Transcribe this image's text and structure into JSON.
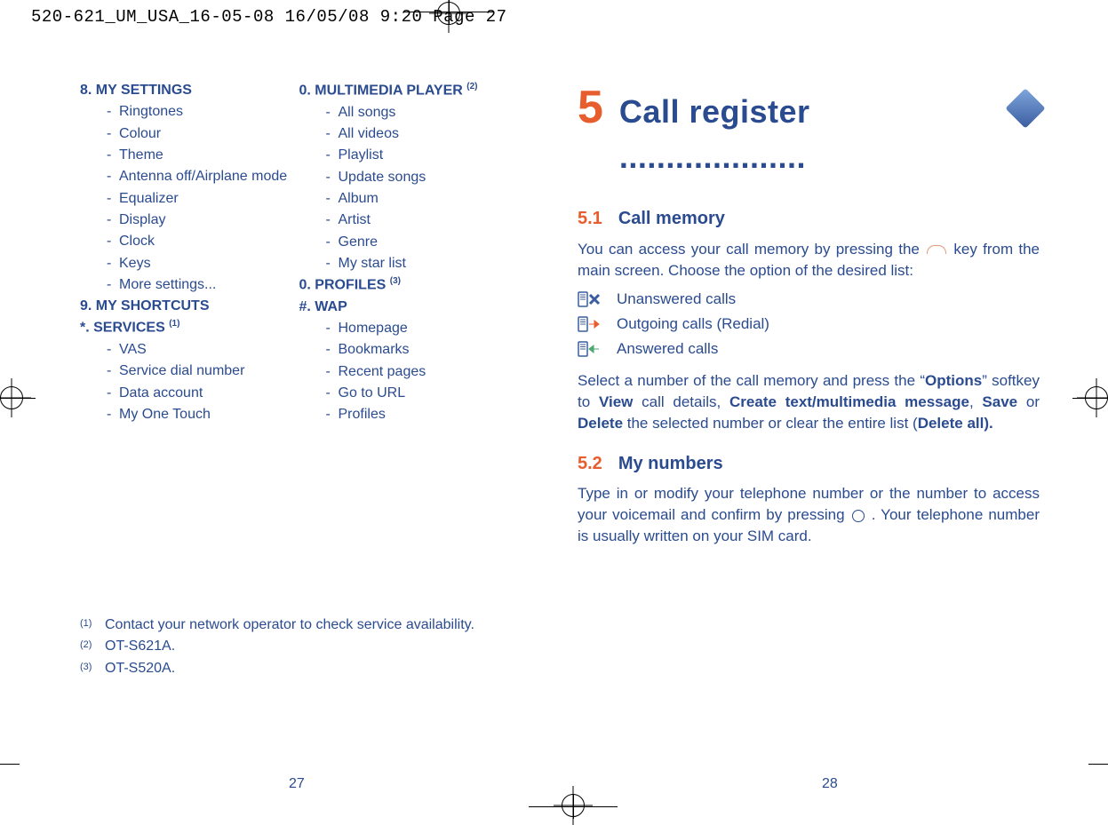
{
  "print": {
    "fileinfo": "520-621_UM_USA_16-05-08  16/05/08  9:20  Page 27"
  },
  "left": {
    "sections": {
      "s8": {
        "title": "8. MY SETTINGS",
        "items": [
          "Ringtones",
          "Colour",
          "Theme",
          "Antenna off/Airplane mode",
          "Equalizer",
          "Display",
          "Clock",
          "Keys",
          "More settings..."
        ]
      },
      "s9": {
        "title": "9. MY SHORTCUTS"
      },
      "sstar": {
        "title_pre": "*.  SERVICES ",
        "sup": "(1)",
        "items": [
          "VAS",
          "Service dial number",
          "Data account",
          "My One Touch"
        ]
      },
      "s0a": {
        "title_pre": "0. MULTIMEDIA PLAYER ",
        "sup": "(2)",
        "items": [
          "All songs",
          "All videos",
          "Playlist",
          "Update songs",
          "Album",
          "Artist",
          "Genre",
          "My star list"
        ]
      },
      "s0b": {
        "title_pre": "0. PROFILES ",
        "sup": "(3)"
      },
      "swap": {
        "title": "#. WAP",
        "items": [
          "Homepage",
          "Bookmarks",
          "Recent pages",
          "Go to URL",
          "Profiles"
        ]
      }
    },
    "footnotes": {
      "n1": "(1)",
      "t1": "Contact your network operator to check service availability.",
      "n2": "(2)",
      "t2": "OT-S621A.",
      "n3": "(3)",
      "t3": "OT-S520A."
    },
    "pagenum": "27"
  },
  "right": {
    "chapter_num": "5",
    "chapter_title": "Call register ....................",
    "s51": {
      "num": "5.1",
      "title": "Call memory"
    },
    "p1a": "You can access your call memory by pressing the ",
    "p1b": " key from the main screen. Choose the option of the desired list:",
    "calls": {
      "unanswered": "Unanswered calls",
      "outgoing": "Outgoing calls (Redial)",
      "answered": "Answered calls"
    },
    "p2a": "Select a number of the call memory and press the “",
    "p2a_b": "Options",
    "p2a2": "” softkey to ",
    "p2b_b1": "View",
    "p2b_1": " call details, ",
    "p2b_b2": "Create text/multimedia message",
    "p2b_2": ", ",
    "p2b_b3": "Save",
    "p2b_3": " or ",
    "p2b_b4": "Delete",
    "p2b_4": " the selected number or clear the entire list (",
    "p2b_b5": "Delete all).",
    "s52": {
      "num": "5.2",
      "title": "My numbers"
    },
    "p3a": "Type in or modify your telephone number or the number to access your voicemail and confirm by pressing ",
    "p3b": ". Your telephone number is usually written on your SIM card.",
    "pagenum": "28"
  }
}
